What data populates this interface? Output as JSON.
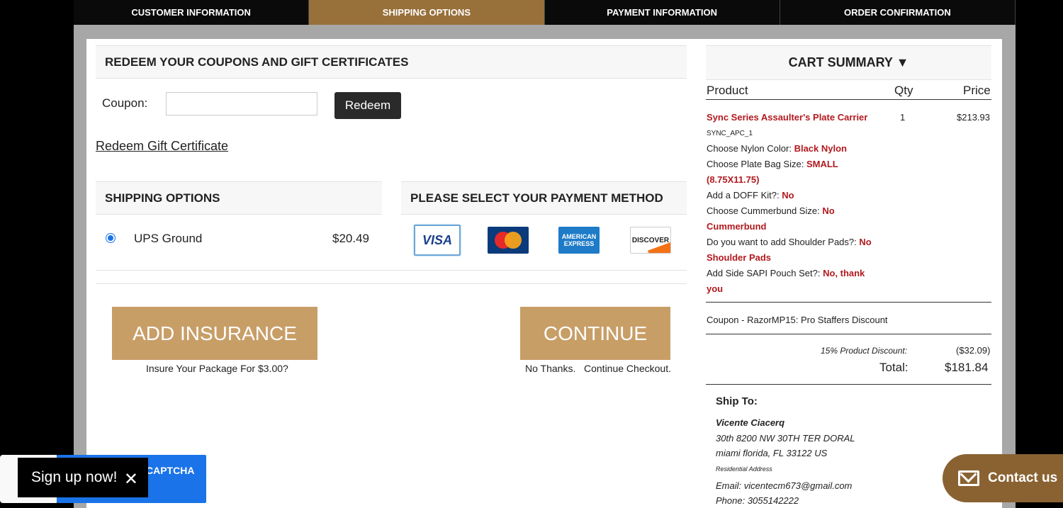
{
  "steps": [
    "CUSTOMER INFORMATION",
    "SHIPPING OPTIONS",
    "PAYMENT INFORMATION",
    "ORDER CONFIRMATION"
  ],
  "active_step": 1,
  "coupons": {
    "title": "REDEEM YOUR COUPONS AND GIFT CERTIFICATES",
    "coupon_label": "Coupon:",
    "coupon_value": "",
    "redeem_label": "Redeem",
    "gift_link": "Redeem Gift Certificate"
  },
  "shipping": {
    "title": "SHIPPING OPTIONS",
    "option": "UPS Ground",
    "price": "$20.49",
    "selected": true
  },
  "payment": {
    "title": "PLEASE SELECT YOUR PAYMENT METHOD",
    "cards": [
      "VISA",
      "MasterCard",
      "AMERICAN EXPRESS",
      "DISCOVER"
    ],
    "selected": "VISA"
  },
  "actions": {
    "insurance_label": "ADD INSURANCE",
    "insurance_sub": "Insure Your Package For $3.00?",
    "continue_label": "CONTINUE",
    "continue_sub": "No Thanks.   Continue Checkout."
  },
  "cart": {
    "title": "CART SUMMARY ▼",
    "headers": {
      "product": "Product",
      "qty": "Qty",
      "price": "Price"
    },
    "item": {
      "name": "Sync Series Assaulter's Plate Carrier",
      "sku": "SYNC_APC_1",
      "qty": "1",
      "price": "$213.93",
      "options": [
        {
          "label": "Choose Nylon Color:",
          "value": "Black Nylon"
        },
        {
          "label": "Choose Plate Bag Size:",
          "value": "SMALL (8.75X11.75)"
        },
        {
          "label": "Add a DOFF Kit?:",
          "value": "No"
        },
        {
          "label": "Choose Cummerbund Size:",
          "value": "No Cummerbund"
        },
        {
          "label": "Do you want to add Shoulder Pads?:",
          "value": "No Shoulder Pads"
        },
        {
          "label": "Add Side SAPI Pouch Set?:",
          "value": "No, thank you"
        }
      ]
    },
    "coupon_line": "Coupon - RazorMP15: Pro Staffers Discount",
    "discount_label": "15% Product Discount:",
    "discount_value": "($32.09)",
    "total_label": "Total:",
    "total_value": "$181.84"
  },
  "ship_to": {
    "title": "Ship To:",
    "name": "Vicente Ciacerq",
    "line1": "30th  8200 NW 30TH TER DORAL",
    "line2": "miami florida, FL 33122 US",
    "type": "Residential Address",
    "email": "Email: vicentecm673@gmail.com",
    "phone": "Phone: 3055142222"
  },
  "overlays": {
    "recaptcha": "CAPTCHA",
    "signup": "Sign up now!",
    "contact": "Contact us"
  },
  "colors": {
    "gold": "#c89e67",
    "active_step": "#98703a",
    "red_text": "#b2191e",
    "contact_bg": "#8a6232"
  }
}
